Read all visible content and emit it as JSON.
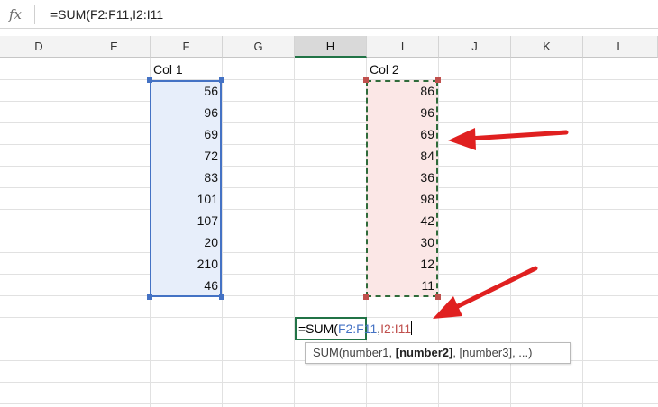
{
  "formula_bar": {
    "fx_label": "fx",
    "formula": "=SUM(F2:F11,I2:I11"
  },
  "columns": [
    "D",
    "E",
    "F",
    "G",
    "H",
    "I",
    "J",
    "K",
    "L"
  ],
  "active_column": "H",
  "col1": {
    "header": "Col 1",
    "values": [
      "56",
      "96",
      "69",
      "72",
      "83",
      "101",
      "107",
      "20",
      "210",
      "46"
    ]
  },
  "col2": {
    "header": "Col 2",
    "values": [
      "86",
      "96",
      "69",
      "84",
      "36",
      "98",
      "42",
      "30",
      "12",
      "11"
    ]
  },
  "editing_cell": {
    "prefix": "=SUM(",
    "ref1": "F2:F11",
    "comma": ",",
    "ref2": "I2:I11"
  },
  "tooltip": {
    "func": "SUM(number1, ",
    "bold_arg": "[number2]",
    "rest": ", [number3], ...)"
  },
  "colors": {
    "range1_border": "#4472c4",
    "range2_border": "#2f6b3a",
    "range2_ref_text": "#c0504d",
    "arrow": "#e02020",
    "active_header_accent": "#217346"
  }
}
